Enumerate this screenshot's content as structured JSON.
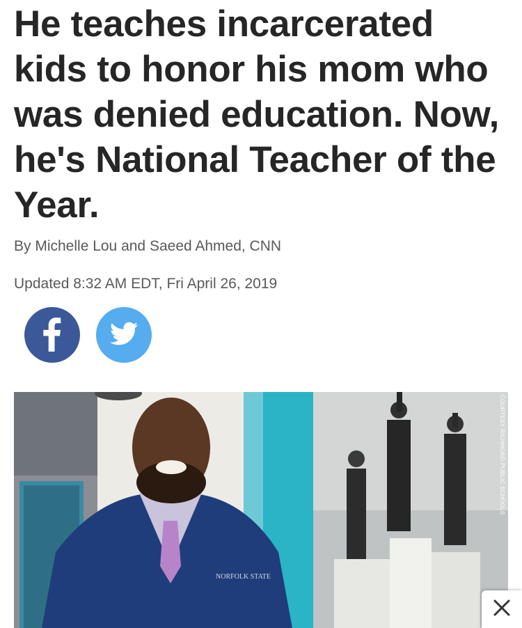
{
  "article": {
    "headline": "He teaches incarcerated kids to honor his mom who was denied education. Now, he's National Teacher of the Year.",
    "byline": "By Michelle Lou and Saeed Ahmed, CNN",
    "timestamp": "Updated 8:32 AM EDT, Fri April 26, 2019"
  },
  "social": {
    "facebook_icon": "facebook-icon",
    "twitter_icon": "twitter-icon",
    "facebook_color": "#3b5998",
    "twitter_color": "#55acee"
  },
  "hero": {
    "credit": "COURTESY RICHMOND PUBLIC SCHOOLS",
    "logo_text": "NORFOLK STATE"
  },
  "overlay": {
    "close_icon": "close-icon"
  }
}
